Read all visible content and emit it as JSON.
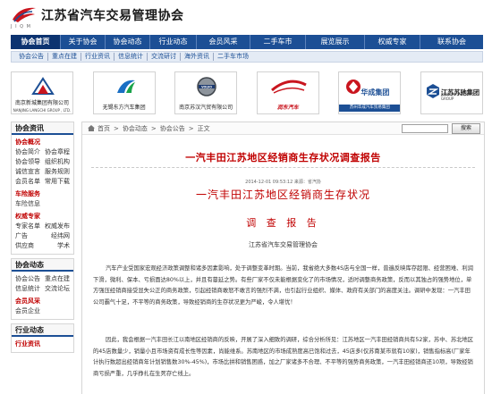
{
  "header": {
    "logo_sub": "J I Q M",
    "title": "江苏省汽车交易管理协会"
  },
  "main_nav": [
    {
      "label": "协会首页",
      "active": true
    },
    {
      "label": "关于协会"
    },
    {
      "label": "协会动态"
    },
    {
      "label": "行业动态"
    },
    {
      "label": "会员风采"
    },
    {
      "label": "二手车市"
    },
    {
      "label": "展览展示"
    },
    {
      "label": "权威专家"
    },
    {
      "label": "联系协会"
    }
  ],
  "sub_nav": [
    "协会公告",
    "重点在建",
    "行业资讯",
    "信息统计",
    "交流研讨",
    "海外资讯",
    "二手车市场"
  ],
  "logos": [
    {
      "name": "南京新城集团有限公司",
      "sub": "NANJING LANGCHI GROUP , LTD."
    },
    {
      "name": "无锡东方汽车集团",
      "sub": ""
    },
    {
      "name": "南京苏汉汽贸有限公司",
      "sub": ""
    },
    {
      "name": "润东汽车",
      "sub": ""
    },
    {
      "name": "华成集团",
      "sub": "苏州华成汽车贸易集团"
    },
    {
      "name": "江苏苏驰集团",
      "sub": "JIANGSU SU CHI GROUP"
    }
  ],
  "sidebar": {
    "assoc": {
      "title": "协会资讯",
      "section1": "协会概况",
      "rows1": [
        [
          "协会简介",
          "协会章程"
        ],
        [
          "协会领导",
          "组织机构"
        ],
        [
          "诚信宣言",
          "服务规则"
        ],
        [
          "会员名单",
          "常用下载"
        ]
      ],
      "section2": "车险服务",
      "link2": "车险信息",
      "section3": "权威专家",
      "rows3": [
        [
          "专家名单",
          "权威发布"
        ],
        [
          "广告",
          "经纬网"
        ],
        [
          "供应商",
          "学术"
        ]
      ]
    },
    "news": {
      "title": "协会动态",
      "rows": [
        [
          "协会公告",
          "重点在建"
        ],
        [
          "信息统计",
          "交流论坛"
        ]
      ],
      "section": "会员风采",
      "link": "会员企业"
    },
    "industry": {
      "title": "行业动态",
      "section": "行业资讯"
    }
  },
  "breadcrumb": {
    "home": "首页",
    "items": [
      "协会动态",
      "协会公告",
      "正文"
    ],
    "separator": ">",
    "search_button": "搜索"
  },
  "article": {
    "title": "一汽丰田江苏地区经销商生存状况调查报告",
    "meta": "2014-12-01 09:53:12    来源：省汽协",
    "subtitle": "一汽丰田江苏地区经销商生存状况",
    "report": "调 查 报 告",
    "org": "江苏省汽车交易管理协会",
    "p1": "汽车产业受国家宏观经济政策调整和诸多因素影响，处于调整变革时期。当前，我省绝大多数4S店与全国一样，普遍反映库存超限、经营困难、利润下滑，微利、保本、亏损面达80%以上，并且有蔓延之势。有些厂家不仅未能根据变化了的市场情况，适时调整商务政策，反而以其独占的强势地位，单方强压经销商接受显失公正的商务政策，引起经销商敢怒不敢言的强烈不满，也引起行业组织、媒体、政府有关部门的高度关注。调研中发现：一汽丰田公司霸气十足，不平等的商务政策，导致经销商的生存状况更为严峻，令人堪忧！",
    "p2": "因此，我会根据一汽丰田长江以南地区经销商的反映，开展了深入细致的调研，综合分析所见：江苏地区一汽丰田经销商共有52家，苏中、苏北地区的45店数量少，销量小且市场资有成长性等因素，尚能维系。苏南地区的市场成熟度高已饱和过去，45店多(仅苏南某市就有10家)，销售指标高(厂家年计执行数超出经销商年计划销售数30%-45%)，市场比拼和销售困惑，加之厂家诸多不合理、不平等的强势商务政策，一汽丰田经销商还10项，导致经销商亏损严重，几乎挣扎在生死存亡线上。"
  },
  "colors": {
    "nav_blue": "#1c4f95",
    "title_red": "#c00000"
  }
}
